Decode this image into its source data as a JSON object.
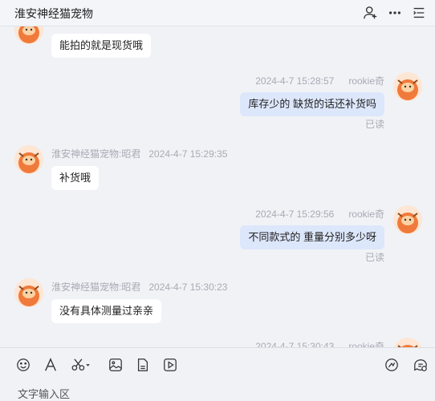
{
  "header": {
    "title": "淮安神经猫宠物",
    "icons": [
      "add-member-icon",
      "more-icon",
      "menu-icon"
    ]
  },
  "messages": [
    {
      "side": "left",
      "sender": "",
      "time": "",
      "text": "能拍的就是现货哦"
    },
    {
      "side": "right",
      "sender": "rookie奇",
      "time": "2024-4-7 15:28:57",
      "text": "库存少的  缺货的话还补货吗",
      "status": "已读"
    },
    {
      "side": "left",
      "sender": "淮安神经猫宠物:昭君",
      "time": "2024-4-7 15:29:35",
      "text": "补货哦"
    },
    {
      "side": "right",
      "sender": "rookie奇",
      "time": "2024-4-7 15:29:56",
      "text": "不同款式的 重量分别多少呀",
      "status": "已读"
    },
    {
      "side": "left",
      "sender": "淮安神经猫宠物:昭君",
      "time": "2024-4-7 15:30:23",
      "text": "没有具体测量过亲亲"
    },
    {
      "side": "right",
      "sender": "rookie奇",
      "time": "2024-4-7 15:30:43",
      "text": ""
    }
  ],
  "toolbar": {
    "left_icons": [
      "emoji-icon",
      "font-icon",
      "scissors-icon",
      "image-icon",
      "file-icon",
      "video-icon"
    ],
    "right_icons": [
      "quick-reply-icon",
      "chat-record-icon"
    ]
  },
  "input": {
    "placeholder": "文字输入区"
  },
  "colors": {
    "background": "#f0f2f6",
    "bubble_left": "#ffffff",
    "bubble_right": "#dde7fb",
    "meta_text": "#a7abb3"
  }
}
